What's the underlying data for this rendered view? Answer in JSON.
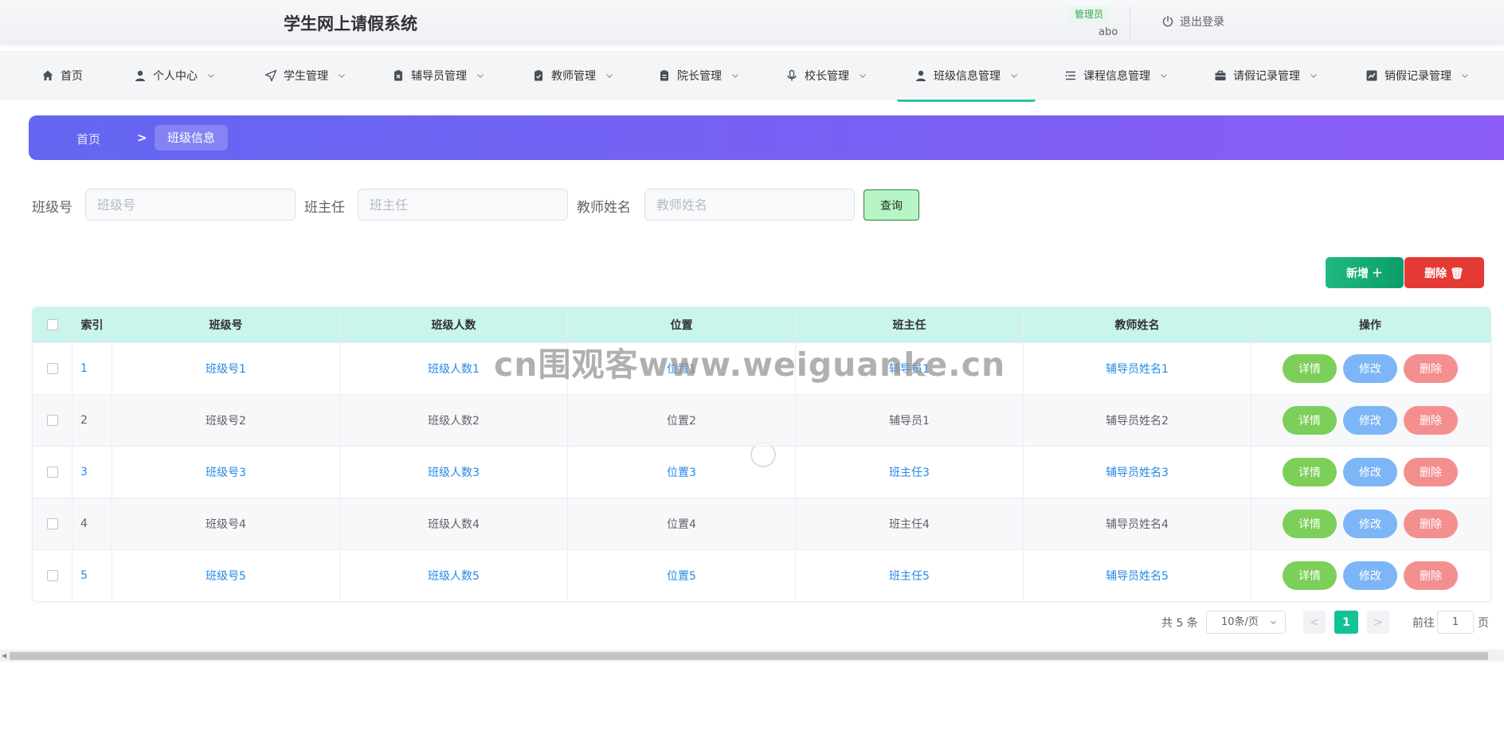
{
  "header": {
    "app_title": "学生网上请假系统",
    "role_badge": "管理员",
    "username": "abo",
    "logout_label": "退出登录"
  },
  "nav": [
    {
      "label": "首页",
      "icon": "home-icon"
    },
    {
      "label": "个人中心",
      "icon": "user-icon"
    },
    {
      "label": "学生管理",
      "icon": "send-icon"
    },
    {
      "label": "辅导员管理",
      "icon": "clipboard-x-icon"
    },
    {
      "label": "教师管理",
      "icon": "clipboard-check-icon"
    },
    {
      "label": "院长管理",
      "icon": "clipboard-icon"
    },
    {
      "label": "校长管理",
      "icon": "microphone-icon"
    },
    {
      "label": "班级信息管理",
      "icon": "user-icon",
      "active": true
    },
    {
      "label": "课程信息管理",
      "icon": "list-icon"
    },
    {
      "label": "请假记录管理",
      "icon": "briefcase-icon"
    },
    {
      "label": "销假记录管理",
      "icon": "chart-icon"
    }
  ],
  "breadcrumb": {
    "home": "首页",
    "separator": ">",
    "current": "班级信息"
  },
  "search": {
    "class_no_label": "班级号",
    "class_no_placeholder": "班级号",
    "head_teacher_label": "班主任",
    "head_teacher_placeholder": "班主任",
    "teacher_name_label": "教师姓名",
    "teacher_name_placeholder": "教师姓名",
    "query_label": "查询"
  },
  "actions": {
    "add_label": "新增 ＋",
    "delete_label": "删除 🗑"
  },
  "table": {
    "columns": [
      "索引",
      "班级号",
      "班级人数",
      "位置",
      "班主任",
      "教师姓名",
      "操作"
    ],
    "rows": [
      {
        "index": "1",
        "class_no": "班级号1",
        "count": "班级人数1",
        "location": "位置1",
        "head_teacher": "辅导员1",
        "teacher_name": "辅导员姓名1"
      },
      {
        "index": "2",
        "class_no": "班级号2",
        "count": "班级人数2",
        "location": "位置2",
        "head_teacher": "辅导员1",
        "teacher_name": "辅导员姓名2"
      },
      {
        "index": "3",
        "class_no": "班级号3",
        "count": "班级人数3",
        "location": "位置3",
        "head_teacher": "班主任3",
        "teacher_name": "辅导员姓名3"
      },
      {
        "index": "4",
        "class_no": "班级号4",
        "count": "班级人数4",
        "location": "位置4",
        "head_teacher": "班主任4",
        "teacher_name": "辅导员姓名4"
      },
      {
        "index": "5",
        "class_no": "班级号5",
        "count": "班级人数5",
        "location": "位置5",
        "head_teacher": "班主任5",
        "teacher_name": "辅导员姓名5"
      }
    ],
    "op_detail": "详情",
    "op_edit": "修改",
    "op_delete": "删除"
  },
  "pagination": {
    "total": "共 5 条",
    "page_size": "10条/页",
    "prev": "<",
    "current": "1",
    "next": ">",
    "goto_prefix": "前往",
    "goto_value": "1",
    "goto_suffix": "页"
  },
  "watermark": "cn围观客www.weiguanke.cn",
  "colors": {
    "accent": "#13c296",
    "breadcrumb_start": "#6366f1",
    "breadcrumb_end": "#8b5cf6",
    "link": "#2589e6",
    "danger": "#e53935"
  }
}
